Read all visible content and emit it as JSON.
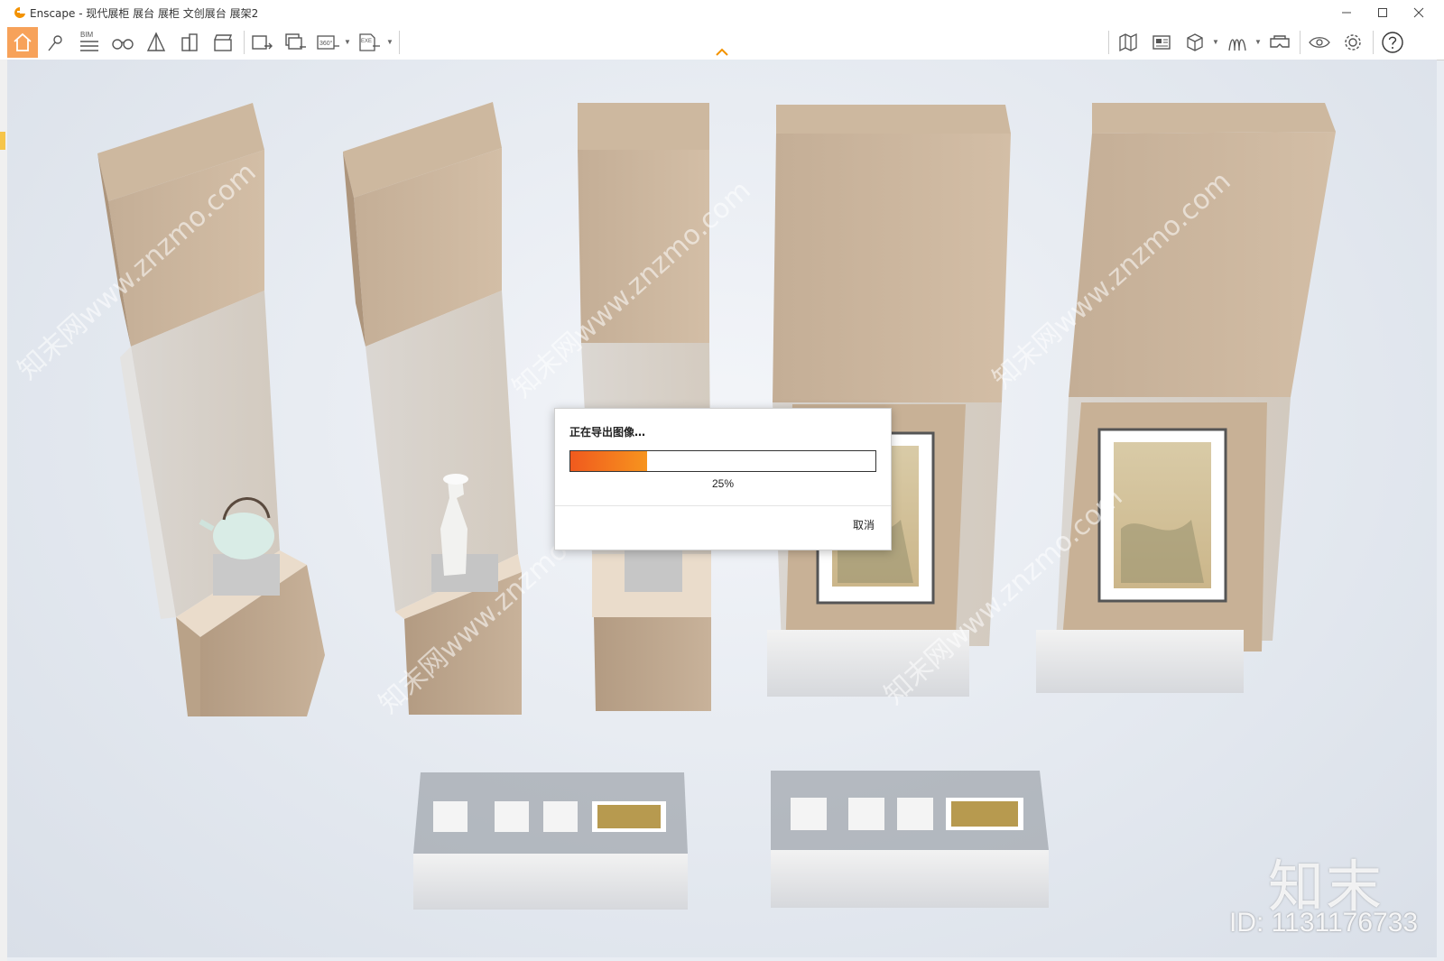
{
  "window": {
    "app_name": "Enscape",
    "title": "Enscape - 现代展柜 展台 展柜 文创展台 展架2"
  },
  "toolbar": {
    "left_icons": [
      "home-icon",
      "location-pin-icon",
      "bim-icon",
      "binoculars-icon",
      "perspective-icon",
      "building-icon",
      "clapperboard-icon",
      "screenshot-export-icon",
      "batch-render-icon",
      "panorama-360-icon",
      "exe-export-icon"
    ],
    "right_icons": [
      "map-icon",
      "asset-library-icon",
      "cube-view-icon",
      "material-icon",
      "vr-headset-icon",
      "visual-settings-icon",
      "gear-icon",
      "help-icon"
    ],
    "bim_label": "BIM",
    "pano_label": "360°",
    "exe_label": "EXE"
  },
  "dialog": {
    "title": "正在导出图像…",
    "progress": 0.25,
    "percent_label": "25%",
    "cancel_label": "取消"
  },
  "watermark": {
    "brand": "知末",
    "id": "ID: 1131176733",
    "diag_text": "知末网www.znzmo.com"
  },
  "colors": {
    "accent": "#f39200",
    "progress_start": "#f05a1e",
    "progress_end": "#f7941e",
    "wood": "#c9b39b"
  }
}
